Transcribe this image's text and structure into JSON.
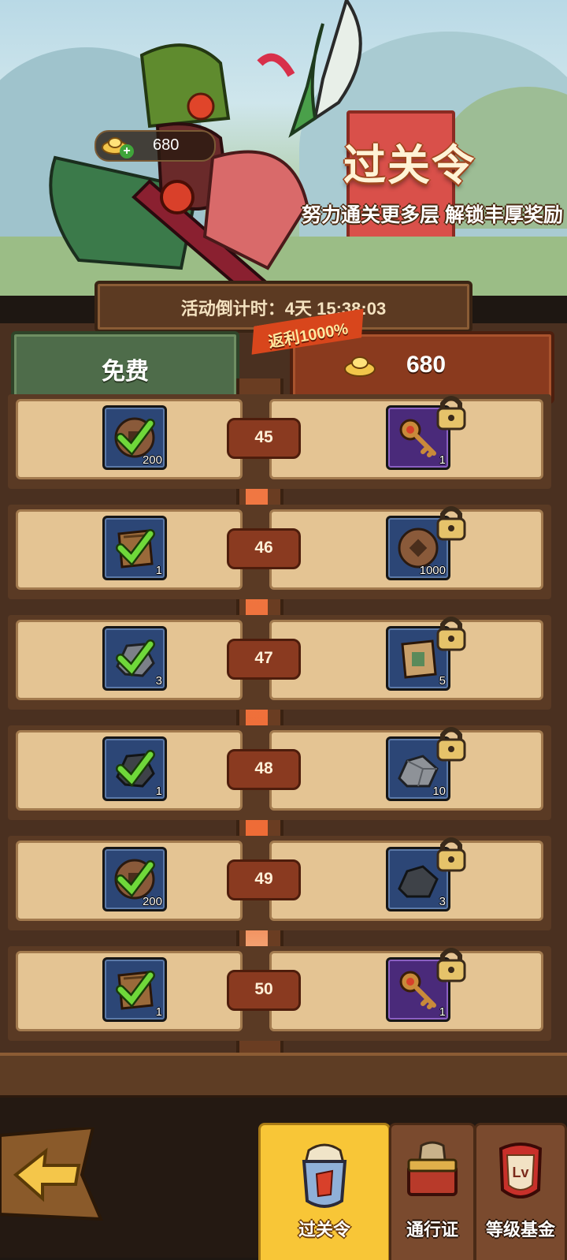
{
  "banner": {
    "title": "过关令",
    "subtitle": "努力通关更多层 解锁丰厚奖励",
    "gold_balance": "680"
  },
  "timer": {
    "text": "活动倒计时：4天 15:38:03"
  },
  "tabs": {
    "free_label": "免费",
    "paid_price": "680",
    "rebate_badge": "返利1000%"
  },
  "rows": [
    {
      "level": "45",
      "free": {
        "icon": "coin-icon",
        "count": "200",
        "claimed": true
      },
      "paid": {
        "icon": "key-icon",
        "count": "1",
        "locked": true
      }
    },
    {
      "level": "46",
      "free": {
        "icon": "scroll-icon",
        "count": "1",
        "claimed": true
      },
      "paid": {
        "icon": "coin-icon",
        "count": "1000",
        "locked": true
      }
    },
    {
      "level": "47",
      "free": {
        "icon": "ore-icon",
        "count": "3",
        "claimed": true
      },
      "paid": {
        "icon": "scroll-icon",
        "count": "5",
        "locked": true
      }
    },
    {
      "level": "48",
      "free": {
        "icon": "dark-ore-icon",
        "count": "1",
        "claimed": true
      },
      "paid": {
        "icon": "ore-icon",
        "count": "10",
        "locked": true
      }
    },
    {
      "level": "49",
      "free": {
        "icon": "coin-icon",
        "count": "200",
        "claimed": true
      },
      "paid": {
        "icon": "dark-ore-icon",
        "count": "3",
        "locked": true
      }
    },
    {
      "level": "50",
      "free": {
        "icon": "scroll-icon",
        "count": "1",
        "claimed": true
      },
      "paid": {
        "icon": "key-icon",
        "count": "1",
        "locked": true
      }
    }
  ],
  "nav": {
    "items": [
      {
        "label": "过关令",
        "active": true
      },
      {
        "label": "通行证",
        "active": false
      },
      {
        "label": "等级基金",
        "active": false
      }
    ]
  }
}
